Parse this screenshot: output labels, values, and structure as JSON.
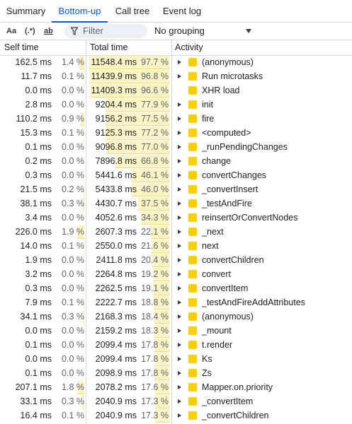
{
  "tabs": [
    {
      "label": "Summary",
      "active": false
    },
    {
      "label": "Bottom-up",
      "active": true
    },
    {
      "label": "Call tree",
      "active": false
    },
    {
      "label": "Event log",
      "active": false
    }
  ],
  "toolbar": {
    "match_case": "Aa",
    "regex": "(.*)",
    "whole_word": "ab",
    "filter_placeholder": "Filter",
    "grouping": "No grouping"
  },
  "columns": {
    "self_time": "Self time",
    "total_time": "Total time",
    "activity": "Activity"
  },
  "colors": {
    "accent": "#0b57d0",
    "activity_square": "#f9d000",
    "bar_fill": "#fdf4c6"
  },
  "rows": [
    {
      "self": "162.5 ms",
      "self_pct": "1.4 %",
      "self_frac": 0.014,
      "total": "11548.4 ms",
      "total_pct": "97.7 %",
      "total_frac": 0.977,
      "name": "(anonymous)",
      "expandable": true
    },
    {
      "self": "11.7 ms",
      "self_pct": "0.1 %",
      "self_frac": 0.001,
      "total": "11439.9 ms",
      "total_pct": "96.8 %",
      "total_frac": 0.968,
      "name": "Run microtasks",
      "expandable": true
    },
    {
      "self": "0.0 ms",
      "self_pct": "0.0 %",
      "self_frac": 0,
      "total": "11409.3 ms",
      "total_pct": "96.6 %",
      "total_frac": 0.966,
      "name": "XHR load",
      "expandable": false
    },
    {
      "self": "2.8 ms",
      "self_pct": "0.0 %",
      "self_frac": 0,
      "total": "9204.4 ms",
      "total_pct": "77.9 %",
      "total_frac": 0.779,
      "name": "init",
      "expandable": true
    },
    {
      "self": "110.2 ms",
      "self_pct": "0.9 %",
      "self_frac": 0.009,
      "total": "9156.2 ms",
      "total_pct": "77.5 %",
      "total_frac": 0.775,
      "name": "fire",
      "expandable": true
    },
    {
      "self": "15.3 ms",
      "self_pct": "0.1 %",
      "self_frac": 0.001,
      "total": "9125.3 ms",
      "total_pct": "77.2 %",
      "total_frac": 0.772,
      "name": "<computed>",
      "expandable": true
    },
    {
      "self": "0.1 ms",
      "self_pct": "0.0 %",
      "self_frac": 0,
      "total": "9096.8 ms",
      "total_pct": "77.0 %",
      "total_frac": 0.77,
      "name": "_runPendingChanges",
      "expandable": true
    },
    {
      "self": "0.2 ms",
      "self_pct": "0.0 %",
      "self_frac": 0,
      "total": "7896.8 ms",
      "total_pct": "66.8 %",
      "total_frac": 0.668,
      "name": "change",
      "expandable": true
    },
    {
      "self": "0.3 ms",
      "self_pct": "0.0 %",
      "self_frac": 0,
      "total": "5441.6 ms",
      "total_pct": "46.1 %",
      "total_frac": 0.461,
      "name": "convertChanges",
      "expandable": true
    },
    {
      "self": "21.5 ms",
      "self_pct": "0.2 %",
      "self_frac": 0.002,
      "total": "5433.8 ms",
      "total_pct": "46.0 %",
      "total_frac": 0.46,
      "name": "_convertInsert",
      "expandable": true
    },
    {
      "self": "38.1 ms",
      "self_pct": "0.3 %",
      "self_frac": 0.003,
      "total": "4430.7 ms",
      "total_pct": "37.5 %",
      "total_frac": 0.375,
      "name": "_testAndFire",
      "expandable": true
    },
    {
      "self": "3.4 ms",
      "self_pct": "0.0 %",
      "self_frac": 0,
      "total": "4052.6 ms",
      "total_pct": "34.3 %",
      "total_frac": 0.343,
      "name": "reinsertOrConvertNodes",
      "expandable": true
    },
    {
      "self": "226.0 ms",
      "self_pct": "1.9 %",
      "self_frac": 0.019,
      "total": "2607.3 ms",
      "total_pct": "22.1 %",
      "total_frac": 0.221,
      "name": "_next",
      "expandable": true
    },
    {
      "self": "14.0 ms",
      "self_pct": "0.1 %",
      "self_frac": 0.001,
      "total": "2550.0 ms",
      "total_pct": "21.6 %",
      "total_frac": 0.216,
      "name": "next",
      "expandable": true
    },
    {
      "self": "1.9 ms",
      "self_pct": "0.0 %",
      "self_frac": 0,
      "total": "2411.8 ms",
      "total_pct": "20.4 %",
      "total_frac": 0.204,
      "name": "convertChildren",
      "expandable": true
    },
    {
      "self": "3.2 ms",
      "self_pct": "0.0 %",
      "self_frac": 0,
      "total": "2264.8 ms",
      "total_pct": "19.2 %",
      "total_frac": 0.192,
      "name": "convert",
      "expandable": true
    },
    {
      "self": "0.3 ms",
      "self_pct": "0.0 %",
      "self_frac": 0,
      "total": "2262.5 ms",
      "total_pct": "19.1 %",
      "total_frac": 0.191,
      "name": "convertItem",
      "expandable": true
    },
    {
      "self": "7.9 ms",
      "self_pct": "0.1 %",
      "self_frac": 0.001,
      "total": "2222.7 ms",
      "total_pct": "18.8 %",
      "total_frac": 0.188,
      "name": "_testAndFireAddAttributes",
      "expandable": true
    },
    {
      "self": "34.1 ms",
      "self_pct": "0.3 %",
      "self_frac": 0.003,
      "total": "2168.3 ms",
      "total_pct": "18.4 %",
      "total_frac": 0.184,
      "name": "(anonymous)",
      "expandable": true
    },
    {
      "self": "0.0 ms",
      "self_pct": "0.0 %",
      "self_frac": 0,
      "total": "2159.2 ms",
      "total_pct": "18.3 %",
      "total_frac": 0.183,
      "name": "_mount",
      "expandable": true
    },
    {
      "self": "0.1 ms",
      "self_pct": "0.0 %",
      "self_frac": 0,
      "total": "2099.4 ms",
      "total_pct": "17.8 %",
      "total_frac": 0.178,
      "name": "t.render",
      "expandable": true
    },
    {
      "self": "0.0 ms",
      "self_pct": "0.0 %",
      "self_frac": 0,
      "total": "2099.4 ms",
      "total_pct": "17.8 %",
      "total_frac": 0.178,
      "name": "Ks",
      "expandable": true
    },
    {
      "self": "0.1 ms",
      "self_pct": "0.0 %",
      "self_frac": 0,
      "total": "2098.9 ms",
      "total_pct": "17.8 %",
      "total_frac": 0.178,
      "name": "Zs",
      "expandable": true
    },
    {
      "self": "207.1 ms",
      "self_pct": "1.8 %",
      "self_frac": 0.018,
      "total": "2078.2 ms",
      "total_pct": "17.6 %",
      "total_frac": 0.176,
      "name": "Mapper.on.priority",
      "expandable": true
    },
    {
      "self": "33.1 ms",
      "self_pct": "0.3 %",
      "self_frac": 0.003,
      "total": "2040.9 ms",
      "total_pct": "17.3 %",
      "total_frac": 0.173,
      "name": "_convertItem",
      "expandable": true
    },
    {
      "self": "16.4 ms",
      "self_pct": "0.1 %",
      "self_frac": 0.001,
      "total": "2040.9 ms",
      "total_pct": "17.3 %",
      "total_frac": 0.173,
      "name": "_convertChildren",
      "expandable": true
    }
  ]
}
